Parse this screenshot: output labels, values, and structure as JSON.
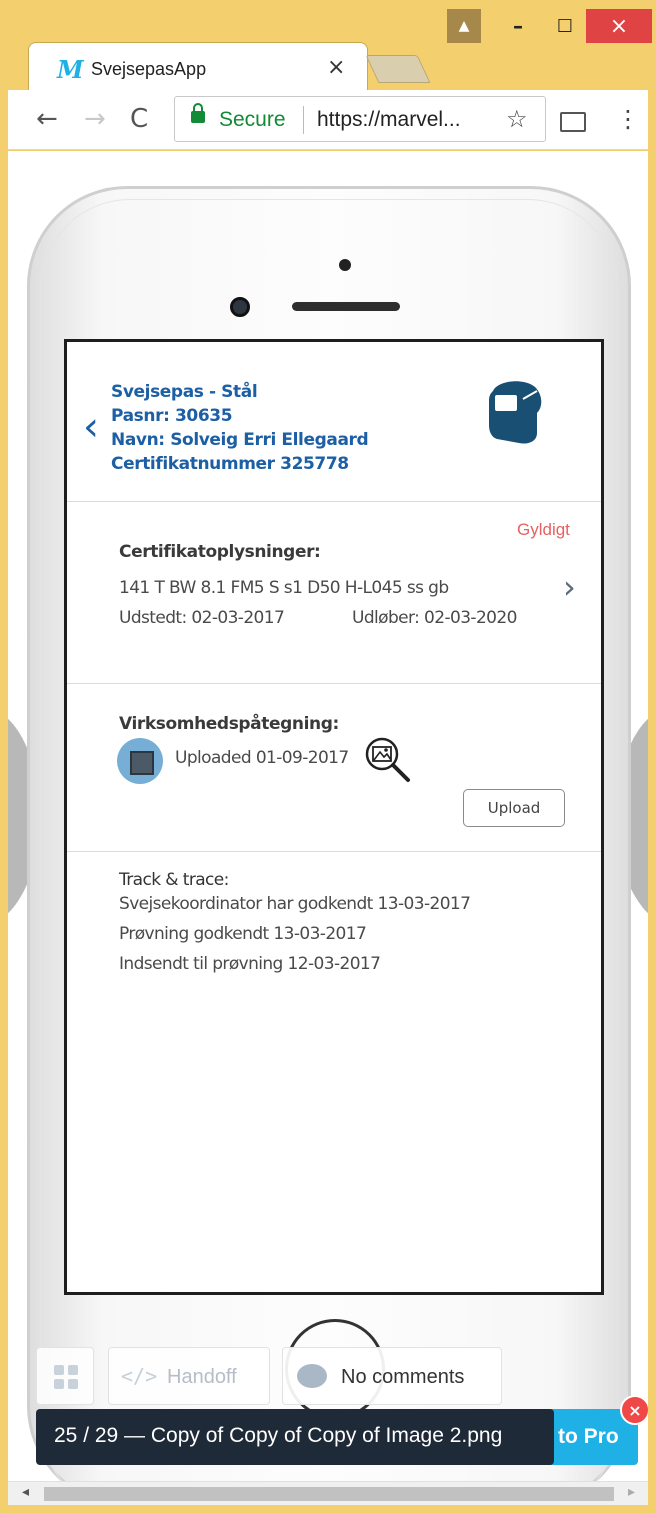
{
  "window": {
    "tab_title": "SvejsepasApp",
    "tab_logo": "M",
    "tab_close": "×",
    "controls": {
      "user": "▲",
      "minimize": "–",
      "maximize": "☐",
      "close": "×"
    }
  },
  "toolbar": {
    "back": "←",
    "forward": "→",
    "reload": "C",
    "secure_label": "Secure",
    "url": "https://marvel...",
    "bookmark": "☆",
    "menu": "⋮"
  },
  "screen": {
    "header": {
      "back_icon": "‹",
      "line1": "Svejsepas - Stål",
      "line2": "Pasnr: 30635",
      "line3": "Navn: Solveig Erri Ellegaard",
      "line4": "Certifikatnummer 325778"
    },
    "certificate": {
      "status": "Gyldigt",
      "title": "Certifikatoplysninger:",
      "spec": "141 T BW 8.1 FM5 S s1 D50 H-L045 ss gb",
      "issued": "Udstedt: 02-03-2017",
      "expires": "Udløber: 02-03-2020",
      "chevron": "›"
    },
    "endorsement": {
      "title": "Virksomhedspåtegning:",
      "uploaded": "Uploaded 01-09-2017",
      "upload_button": "Upload"
    },
    "track": {
      "title": "Track & trace:",
      "entries": [
        "Svejsekoordinator har godkendt 13-03-2017",
        "Prøvning godkendt 13-03-2017",
        "Indsendt til prøvning 12-03-2017"
      ]
    }
  },
  "marvel": {
    "handoff_icon": "</>",
    "handoff_label": "Handoff",
    "comments_label": "No comments",
    "file_label": "25 / 29 — Copy of Copy of Copy of Image 2.png",
    "pro_label": "to Pro",
    "close": "×"
  },
  "scrollbar": {
    "left": "◂",
    "right": "▸"
  },
  "colors": {
    "window_frame": "#f3cf6d",
    "accent_blue": "#1d5fa5",
    "status_valid": "#e76161",
    "marvel_blue": "#1fb0e5",
    "tooltip_dark": "#1f2a38"
  }
}
